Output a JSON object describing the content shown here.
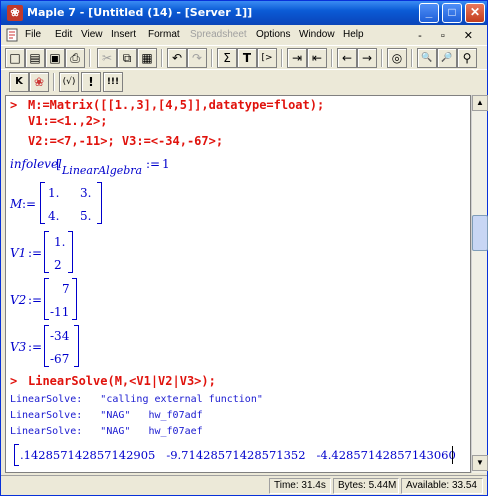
{
  "window": {
    "title": "Maple 7 - [Untitled (14) - [Server 1]]",
    "close_glyph": "✕",
    "minimize_glyph": "_",
    "maximize_glyph": "□"
  },
  "menubar": {
    "items": [
      "File",
      "Edit",
      "View",
      "Insert",
      "Format",
      "Spreadsheet",
      "Options",
      "Window",
      "Help"
    ],
    "disabled": [
      "Spreadsheet"
    ],
    "mdi_controls": "- ▫ ✕"
  },
  "toolbar1": {
    "buttons": [
      {
        "icon": "new-icon",
        "glyph": "□"
      },
      {
        "icon": "open-icon",
        "glyph": "▤"
      },
      {
        "icon": "save-icon",
        "glyph": "▣"
      },
      {
        "icon": "print-icon",
        "glyph": "⎙"
      },
      {
        "icon": "cut-icon",
        "glyph": "✂"
      },
      {
        "icon": "copy-icon",
        "glyph": "⧉"
      },
      {
        "icon": "paste-icon",
        "glyph": "▦"
      },
      {
        "icon": "undo-icon",
        "glyph": "↶"
      },
      {
        "icon": "redo-icon",
        "glyph": "↷"
      },
      {
        "icon": "sum-icon",
        "glyph": "Σ"
      },
      {
        "icon": "text-icon",
        "glyph": "T"
      },
      {
        "icon": "insert-prompt-icon",
        "glyph": "[>"
      },
      {
        "icon": "indent-icon",
        "glyph": "⇥"
      },
      {
        "icon": "outdent-icon",
        "glyph": "⇤"
      },
      {
        "icon": "back-arrow-icon",
        "glyph": "←"
      },
      {
        "icon": "forward-arrow-icon",
        "glyph": "→"
      },
      {
        "icon": "stop-icon",
        "glyph": "◎"
      },
      {
        "icon": "zoom-in-icon",
        "glyph": "🔍"
      },
      {
        "icon": "zoom-out-icon",
        "glyph": "🔎"
      },
      {
        "icon": "zoom-reset-icon",
        "glyph": "⚲"
      }
    ]
  },
  "toolbar2": {
    "buttons": [
      {
        "icon": "keyword-icon",
        "glyph": "K"
      },
      {
        "icon": "maple-leaf-icon",
        "glyph": "❀"
      },
      {
        "icon": "auto-exec-icon",
        "glyph": "(√)"
      },
      {
        "icon": "exclaim-icon",
        "glyph": "!"
      },
      {
        "icon": "exec-all-icon",
        "glyph": "!!!"
      }
    ]
  },
  "worksheet": {
    "prompt": ">",
    "cmd1_line1": "M:=Matrix([[1.,3],[4,5]],datatype=float);",
    "cmd1_line2": "V1:=<1.,2>;",
    "cmd1_line3": "V2:=<7,-11>; V3:=<-34,-67>;",
    "infolevel_label": "infolevel",
    "infolevel_sub": "LinearAlgebra",
    "infolevel_val": "1",
    "m_label": "M",
    "m_cells": [
      "1.",
      "3.",
      "4.",
      "5."
    ],
    "v1_label": "V1",
    "v1_cells": [
      "1.",
      "2"
    ],
    "v2_label": "V2",
    "v2_cells": [
      "7",
      "-11"
    ],
    "v3_label": "V3",
    "v3_cells": [
      "-34",
      "-67"
    ],
    "assign": ":=",
    "cmd2": "LinearSolve(M,<V1|V2|V3>);",
    "info_lines": [
      "LinearSolve:   \"calling external function\"",
      "LinearSolve:   \"NAG\"   hw_f07adf",
      "LinearSolve:   \"NAG\"   hw_f07aef"
    ],
    "result": ".142857142857142905   -9.71428571428571352   -4.42857142857143060"
  },
  "statusbar": {
    "time": "Time: 31.4s",
    "bytes": "Bytes: 5.44M",
    "available": "Available: 33.54"
  }
}
